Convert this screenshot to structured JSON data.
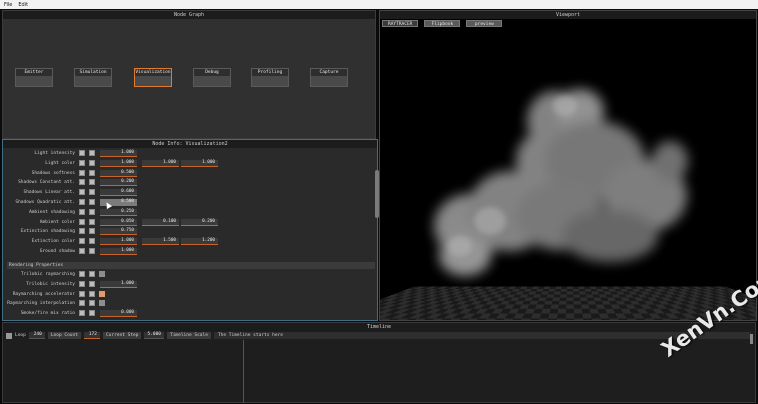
{
  "menu": [
    "File",
    "Edit"
  ],
  "node_graph": {
    "title": "Node Graph",
    "nodes": [
      {
        "label": "Emitter",
        "selected": false
      },
      {
        "label": "Simulation",
        "selected": false
      },
      {
        "label": "Visualization",
        "selected": true
      },
      {
        "label": "Debug",
        "selected": false
      },
      {
        "label": "Profiling",
        "selected": false
      },
      {
        "label": "Capture",
        "selected": false
      }
    ]
  },
  "node_info": {
    "title": "Node Info: Visualization2",
    "rows": [
      {
        "label": "Light intensity",
        "values": [
          "1.000"
        ]
      },
      {
        "label": "Light color",
        "values": [
          "1.000",
          "1.000",
          "1.000"
        ]
      },
      {
        "label": "Shadows softness",
        "values": [
          "0.500"
        ]
      },
      {
        "label": "Shadows Constant att.",
        "values": [
          "0.200"
        ]
      },
      {
        "label": "Shadows Linear att.",
        "values": [
          "0.600"
        ]
      },
      {
        "label": "Shadows Quadratic att.",
        "values": [
          "0.500"
        ],
        "highlight": true
      },
      {
        "label": "Ambient shadowing",
        "values": [
          "0.250"
        ]
      },
      {
        "label": "Ambient color",
        "values": [
          "0.050",
          "0.100",
          "0.200"
        ]
      },
      {
        "label": "Extinction shadowing",
        "values": [
          "0.750"
        ]
      },
      {
        "label": "Extinction color",
        "values": [
          "1.000",
          "1.500",
          "1.200"
        ]
      },
      {
        "label": "Ground shadow",
        "values": [
          "1.000"
        ]
      }
    ],
    "section_label": "Rendering Properties",
    "rows2": [
      {
        "label": "Trilobic raymarching",
        "check": false
      },
      {
        "label": "Trilobic intensity",
        "values": [
          "1.000"
        ]
      },
      {
        "label": "Raymarching accelerator",
        "check": true
      },
      {
        "label": "Raymarching interpolation",
        "check": false
      },
      {
        "label": "Smoke/fire mix ratio",
        "values": [
          "0.000"
        ]
      }
    ]
  },
  "viewport": {
    "title": "Viewport",
    "tabs": [
      "RAYTRACER",
      "Flipbook",
      "preview"
    ]
  },
  "timeline": {
    "title": "Timeline",
    "loop_label": "Loop",
    "loop_value": "240",
    "loop_count_label": "Loop Count",
    "loop_count_value": "172",
    "current_step_label": "Current Step",
    "current_step_value": "5.000",
    "timeline_scale_label": "Timeline Scale",
    "message": "The Timeline starts here"
  },
  "watermark": "XenVn.Com",
  "colors": {
    "accent": "#e07a2e",
    "panel": "#2b2b2b",
    "border_active": "#3f6e86"
  }
}
